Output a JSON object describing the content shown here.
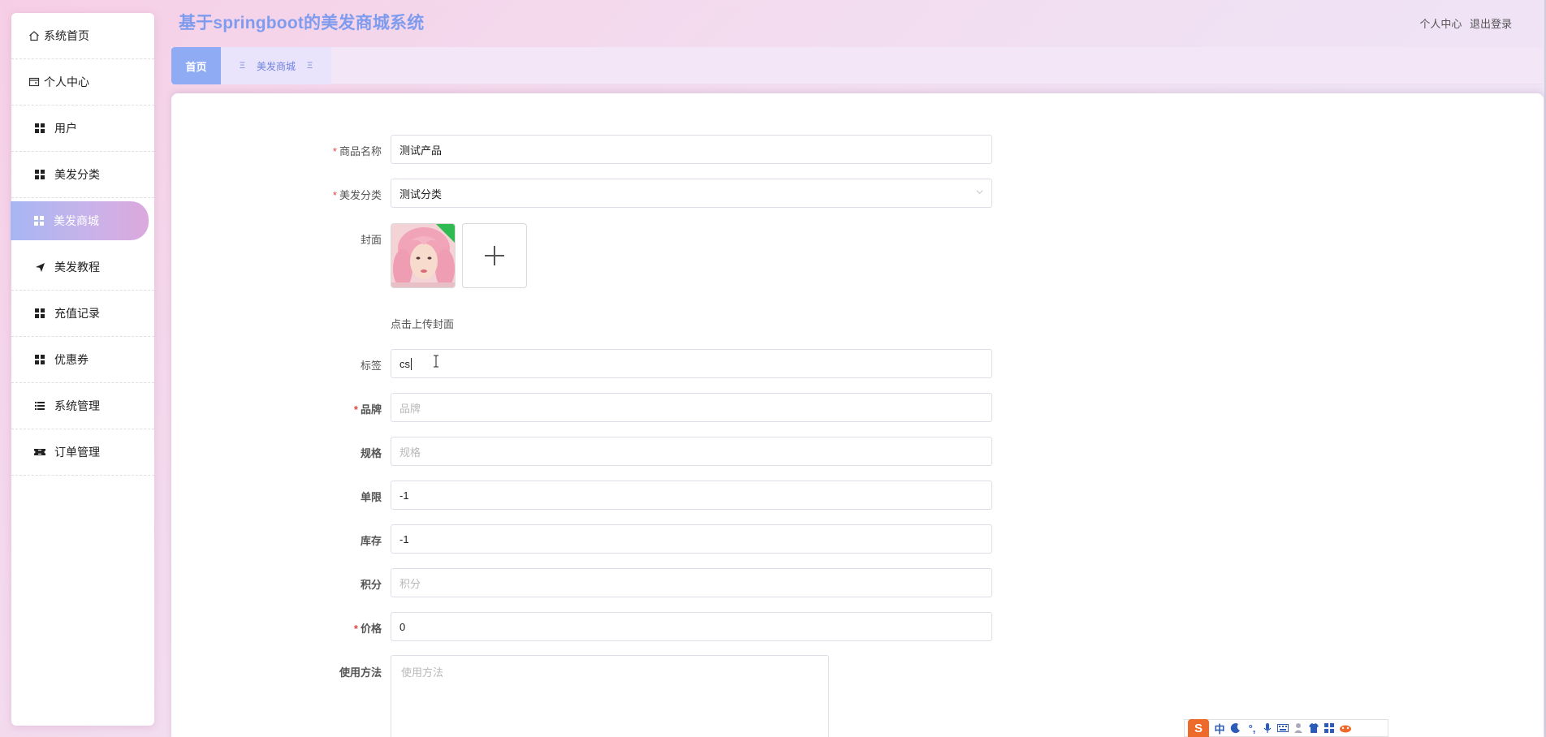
{
  "header": {
    "title": "基于springboot的美发商城系统",
    "links": [
      "个人中心",
      "退出登录"
    ]
  },
  "sidebar": {
    "items": [
      {
        "label": "系统首页",
        "icon": "home-icon"
      },
      {
        "label": "个人中心",
        "icon": "profile-icon"
      },
      {
        "label": "用户",
        "icon": "grid-icon"
      },
      {
        "label": "美发分类",
        "icon": "grid-icon"
      },
      {
        "label": "美发商城",
        "icon": "grid-icon",
        "active": true
      },
      {
        "label": "美发教程",
        "icon": "send-icon"
      },
      {
        "label": "充值记录",
        "icon": "grid-icon"
      },
      {
        "label": "优惠券",
        "icon": "grid-icon"
      },
      {
        "label": "系统管理",
        "icon": "list-icon"
      },
      {
        "label": "订单管理",
        "icon": "ticket-icon"
      }
    ]
  },
  "tabs": {
    "home": "首页",
    "current": "美发商城",
    "glyph": "Ξ"
  },
  "form": {
    "name": {
      "label": "商品名称",
      "value": "测试产品",
      "required": true
    },
    "category": {
      "label": "美发分类",
      "value": "测试分类",
      "required": true
    },
    "cover": {
      "label": "封面",
      "hint": "点击上传封面"
    },
    "tag": {
      "label": "标签",
      "value": "cs"
    },
    "brand": {
      "label": "品牌",
      "placeholder": "品牌",
      "required": true
    },
    "spec": {
      "label": "规格",
      "placeholder": "规格"
    },
    "limit": {
      "label": "单限",
      "value": "-1"
    },
    "stock": {
      "label": "库存",
      "value": "-1"
    },
    "points": {
      "label": "积分",
      "placeholder": "积分"
    },
    "price": {
      "label": "价格",
      "value": "0",
      "required": true
    },
    "usage": {
      "label": "使用方法",
      "placeholder": "使用方法"
    },
    "required_mark": "*"
  },
  "ime": {
    "logo": "S",
    "mode": "中",
    "punct": "°,"
  },
  "colors": {
    "accent": "#7f9bee",
    "tab_active": "#8fabf3",
    "required": "#e04646"
  }
}
